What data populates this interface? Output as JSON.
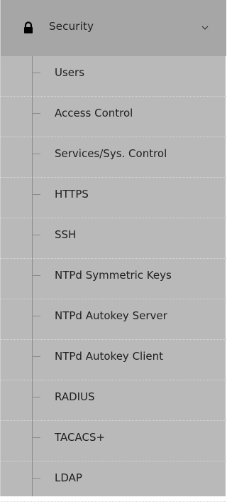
{
  "menu": {
    "header": {
      "label": "Security",
      "icon": "lock-icon",
      "expand_icon": "chevron-down-icon"
    },
    "items": [
      {
        "label": "Users"
      },
      {
        "label": "Access Control"
      },
      {
        "label": "Services/Sys. Control"
      },
      {
        "label": "HTTPS"
      },
      {
        "label": "SSH"
      },
      {
        "label": "NTPd Symmetric Keys"
      },
      {
        "label": "NTPd Autokey Server"
      },
      {
        "label": "NTPd Autokey Client"
      },
      {
        "label": "RADIUS"
      },
      {
        "label": "TACACS+"
      },
      {
        "label": "LDAP"
      }
    ]
  }
}
